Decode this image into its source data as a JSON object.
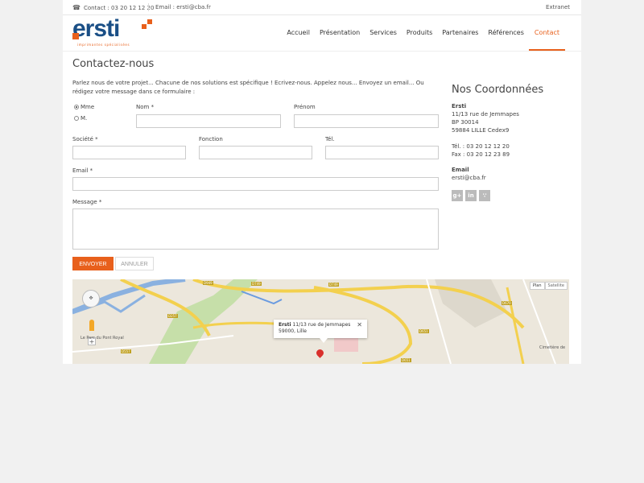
{
  "topbar": {
    "contact": "Contact : 03 20 12 12 20",
    "email": "Email : ersti@cba.fr",
    "extranet": "Extranet"
  },
  "logo": {
    "name": "ersti",
    "tagline": "imprimantes spécialisées"
  },
  "nav": [
    {
      "label": "Accueil"
    },
    {
      "label": "Présentation"
    },
    {
      "label": "Services"
    },
    {
      "label": "Produits"
    },
    {
      "label": "Partenaires"
    },
    {
      "label": "Références"
    },
    {
      "label": "Contact"
    }
  ],
  "main": {
    "title": "Contactez-nous",
    "intro": "Parlez nous de votre projet... Chacune de nos solutions est spécifique ! Ecrivez-nous. Appelez nous... Envoyez un email... Ou rédigez votre message dans ce formulaire :"
  },
  "form": {
    "civility": [
      {
        "label": "Mme",
        "checked": true
      },
      {
        "label": "M.",
        "checked": false
      }
    ],
    "nom_label": "Nom *",
    "prenom_label": "Prénom",
    "societe_label": "Société *",
    "fonction_label": "Fonction",
    "tel_label": "Tél.",
    "email_label": "Email *",
    "message_label": "Message *",
    "send_label": "ENVOYER",
    "cancel_label": "ANNULER"
  },
  "coordonnees": {
    "title": "Nos Coordonnées",
    "company": "Ersti",
    "address1": "11/13 rue de Jemmapes",
    "address2": "BP 30014",
    "address3": "59884 LILLE Cedex9",
    "tel": "Tél. : 03 20 12 12 20",
    "fax": "Fax : 03 20 12 23 89",
    "email_title": "Email",
    "email": "ersti@cba.fr",
    "social": [
      "google-plus-icon",
      "linkedin-icon",
      "rss-icon"
    ]
  },
  "map": {
    "plan_label": "Plan",
    "satellite_label": "Satellite",
    "info_company": "Ersti",
    "info_address": "11/13 rue de Jemmapes",
    "info_city": "59000, Lille",
    "road_labels": [
      "D949",
      "D749",
      "D749",
      "D257",
      "D557",
      "D651",
      "D670",
      "D651"
    ],
    "place_labels": [
      "Le Parc du Pont Royal",
      "Cimetière de"
    ]
  }
}
